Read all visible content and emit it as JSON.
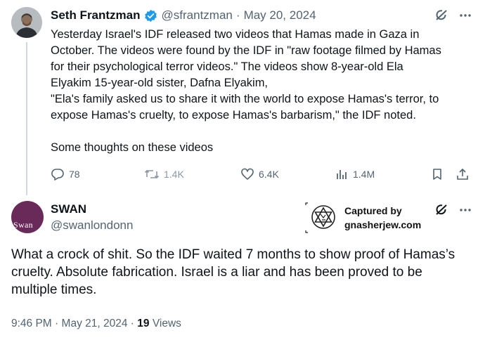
{
  "tweet1": {
    "author_name": "Seth Frantzman",
    "handle": "@sfrantzman",
    "separator": "·",
    "date": "May 20, 2024",
    "text": "Yesterday Israel's IDF released two videos that Hamas made in Gaza in\nOctober. The videos were found by the IDF in \"raw footage filmed by Hamas\nfor their psychological terror videos.\" The videos show 8-year-old Ela\nElyakim  15-year-old sister, Dafna Elyakim,\n\"Ela's family asked us to share it with the world to expose Hamas's terror, to\nexpose Hamas's cruelty, to expose Hamas's barbarism,\" the IDF noted.",
    "text2": "Some thoughts on these videos",
    "replies": "78",
    "reposts": "1.4K",
    "likes": "6.4K",
    "views": "1.4M",
    "icons": [
      "verified-badge-icon",
      "grok-icon",
      "more-icon",
      "reply-icon",
      "repost-icon",
      "like-icon",
      "views-icon",
      "bookmark-icon",
      "share-icon"
    ],
    "colors": {
      "verified": "#1d9bf0",
      "repost_muted": "#8b98a5"
    }
  },
  "tweet2": {
    "author_name": "SWAN",
    "handle": "@swanlondonn",
    "avatar_text": "Swan",
    "text": "What a crock of shit. So the IDF waited 7 months to show proof of Hamas’s cruelty. Absolute fabrication. Israel is a liar and has been proved to be multiple times.",
    "time": "9:46 PM",
    "separator": "·",
    "date": "May 21, 2024",
    "views_count": "19",
    "views_label": "Views",
    "colors": {
      "avatar_bg": "#6a2a59"
    }
  },
  "watermark": {
    "line1": "Captured by",
    "line2": "gnasherjew.com"
  }
}
